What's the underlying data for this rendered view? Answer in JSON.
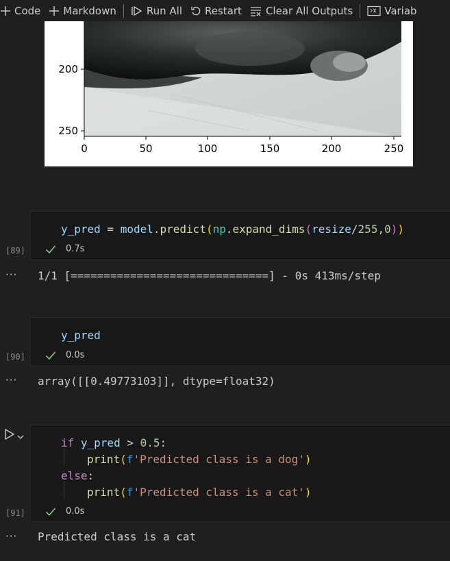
{
  "toolbar": {
    "code_label": "Code",
    "markdown_label": "Markdown",
    "run_all_label": "Run All",
    "restart_label": "Restart",
    "clear_label": "Clear All Outputs",
    "variables_label": "Variab"
  },
  "plot": {
    "y_ticks": [
      "200",
      "250"
    ],
    "x_ticks": [
      "0",
      "50",
      "100",
      "150",
      "200",
      "250"
    ]
  },
  "cells": [
    {
      "exec_count": "[89]",
      "time": "0.7s",
      "code": {
        "t1": "y_pred",
        "t2": " = ",
        "t3": "model",
        "t4": ".",
        "t5": "predict",
        "t6": "(",
        "t7": "np",
        "t8": ".",
        "t9": "expand_dims",
        "t10": "(",
        "t11": "resize",
        "t12": "/",
        "t13": "255",
        "t14": ",",
        "t15": "0",
        "t16": ")",
        "t17": ")"
      },
      "output": "1/1 [==============================] - 0s 413ms/step"
    },
    {
      "exec_count": "[90]",
      "time": "0.0s",
      "code": {
        "t1": "y_pred"
      },
      "output": "array([[0.49773103]], dtype=float32)"
    },
    {
      "exec_count": "[91]",
      "time": "0.0s",
      "code": {
        "l1_kw": "if",
        "l1_var": " y_pred",
        "l1_op": " > ",
        "l1_num": "0.5",
        "l1_colon": ":",
        "l2_fn": "print",
        "l2_p1": "(",
        "l2_f": "f",
        "l2_str": "'Predicted class is a dog'",
        "l2_p2": ")",
        "l3_kw": "else",
        "l3_colon": ":",
        "l4_fn": "print",
        "l4_p1": "(",
        "l4_f": "f",
        "l4_str": "'Predicted class is a cat'",
        "l4_p2": ")"
      },
      "output": "Predicted class is a cat"
    }
  ],
  "output_dots": "···"
}
